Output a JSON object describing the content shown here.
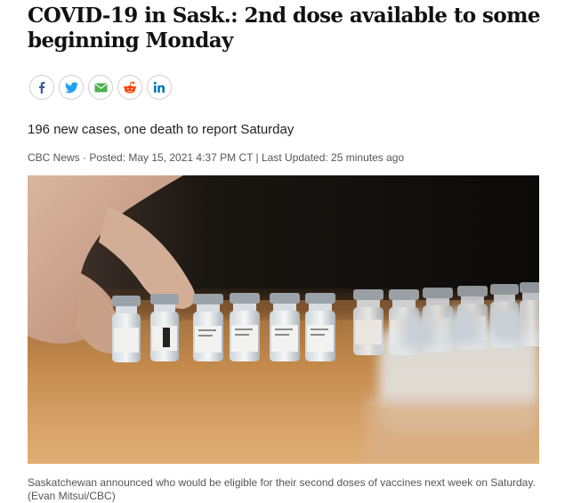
{
  "article": {
    "headline": "COVID-19 in Sask.: 2nd dose available to some beginning Monday",
    "subheadline": "196 new cases, one death to report Saturday",
    "byline": "CBC News · Posted: May 15, 2021 4:37 PM CT | Last Updated: 25 minutes ago"
  },
  "share": [
    {
      "icon": "facebook-icon",
      "color": "#3b5998"
    },
    {
      "icon": "twitter-icon",
      "color": "#1da1f2"
    },
    {
      "icon": "email-icon",
      "color": "#4caf50"
    },
    {
      "icon": "reddit-icon",
      "color": "#ff4500"
    },
    {
      "icon": "linkedin-icon",
      "color": "#0077b5"
    }
  ],
  "photo": {
    "caption": "Saskatchewan announced who would be eligible for their second doses of vaccines next week on Saturday. (Evan Mitsui/CBC)"
  }
}
